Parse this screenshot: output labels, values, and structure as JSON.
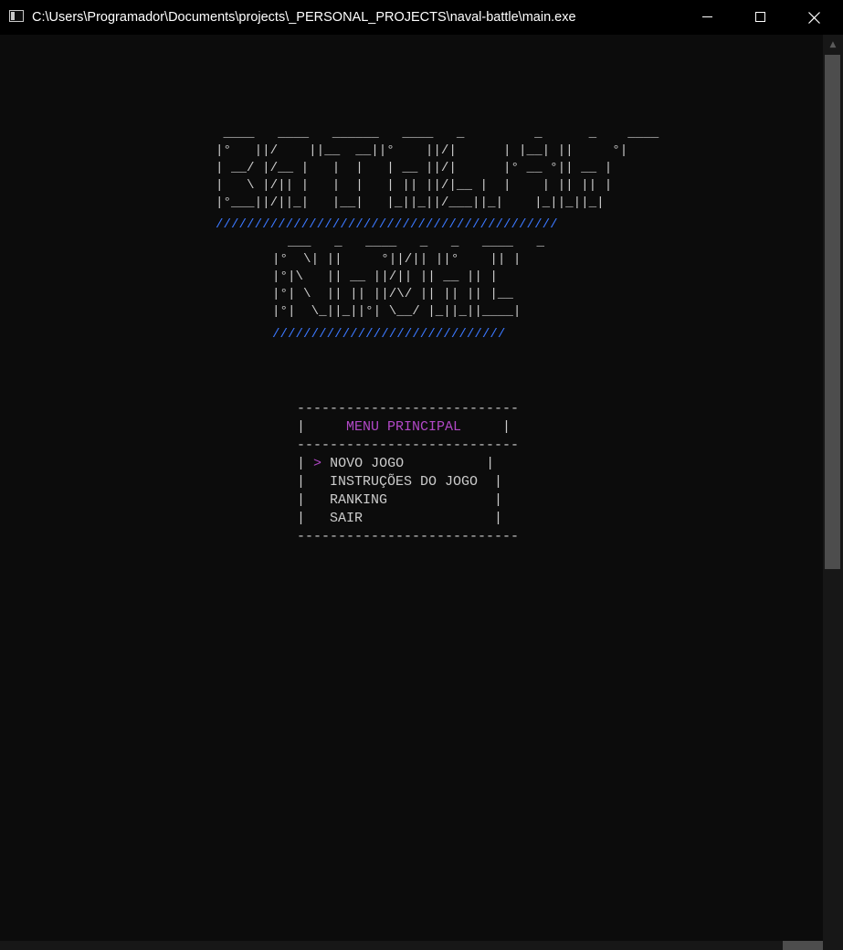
{
  "window": {
    "title": "C:\\Users\\Programador\\Documents\\projects\\_PERSONAL_PROJECTS\\naval-battle\\main.exe",
    "controls": {
      "minimize_icon": "minimize-icon",
      "maximize_icon": "maximize-icon",
      "close_icon": "close-icon"
    }
  },
  "banner": {
    "batalha_art": " ____   ____   ______   ____   _         _      _    ____\n|°   ||/    ||__  __||°    ||/|      | |__| ||     °|\n| __/ |/__ |   |  |   | __ ||/|      |° __ °|| __ |\n|   \\ |/|| |   |  |   | || ||/|__ |  |    | || || |\n|°___||/||_|   |__|   |_||_||/___||_|    |_||_||_|",
    "batalha_underline": "////////////////////////////////////////////",
    "naval_art": "  ___   _   ____   _   _   ____   _\n|°  \\| ||     °||/|| ||°    || |\n|°|\\   || __ ||/|| || __ || |\n|°| \\  || || ||/\\/ || || || |__\n|°|  \\_||_||°| \\__/ |_||_||____|",
    "naval_underline": "//////////////////////////////"
  },
  "menu": {
    "border_top": "---------------------------",
    "title_left": "|     ",
    "title": "MENU PRINCIPAL",
    "title_right": "     |",
    "border_mid": "---------------------------",
    "selector": ">",
    "items": [
      {
        "label": "NOVO JOGO",
        "selected": true
      },
      {
        "label": "INSTRUÇÕES DO JOGO",
        "selected": false
      },
      {
        "label": "RANKING",
        "selected": false
      },
      {
        "label": "SAIR",
        "selected": false
      }
    ],
    "border_bottom": "---------------------------"
  },
  "colors": {
    "background": "#0c0c0c",
    "text": "#cccccc",
    "accent_purple": "#b148c6",
    "accent_blue": "#3b78ff"
  }
}
